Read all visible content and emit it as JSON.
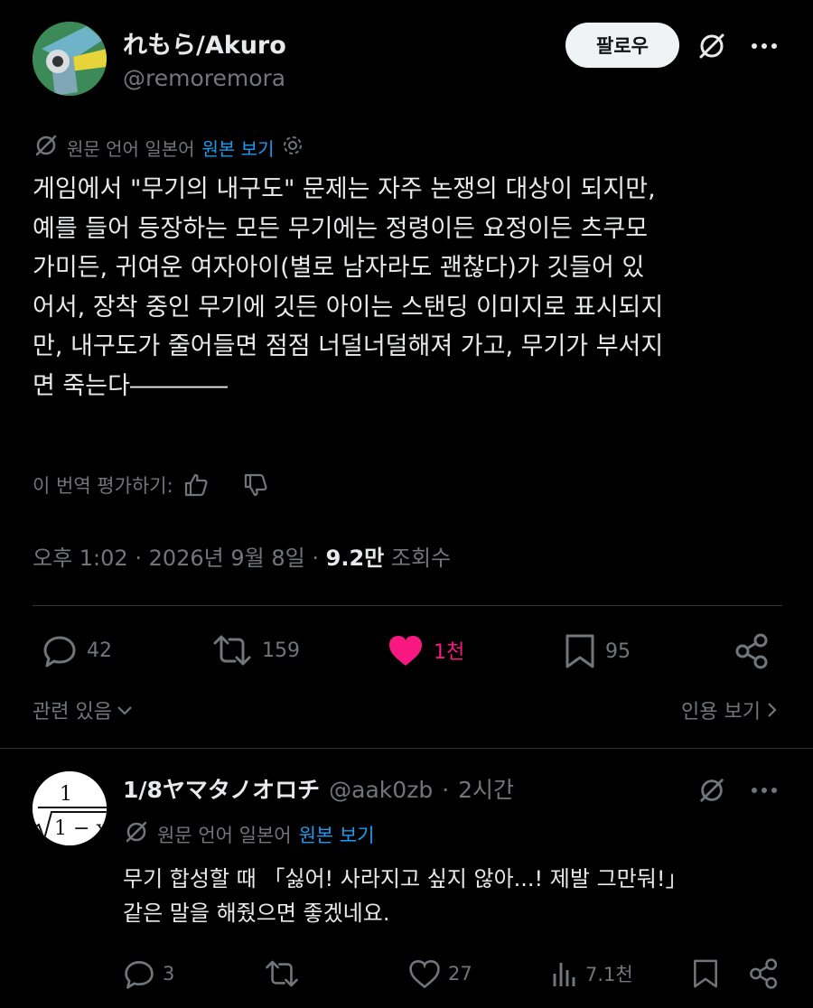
{
  "author": {
    "display_name": "れもら/Akuro",
    "handle": "@remoremora"
  },
  "header": {
    "follow_label": "팔로우"
  },
  "translation": {
    "note": "원문 언어 일본어",
    "show_original": "원본 보기"
  },
  "post": {
    "text": "게임에서 \"무기의 내구도\" 문제는 자주 논쟁의 대상이 되지만,\n예를 들어 등장하는 모든 무기에는 정령이든 요정이든 츠쿠모\n가미든, 귀여운 여자아이(별로 남자라도 괜찮다)가 깃들어 있\n어서, 장착 중인 무기에 깃든 아이는 스탠딩 이미지로 표시되지\n만, 내구도가 줄어들면 점점 너덜너덜해져 가고, 무기가 부서지\n면 죽는다――――",
    "rate_label": "이 번역 평가하기:",
    "time": "오후 1:02",
    "date": "2026년 9월 8일",
    "views_count": "9.2만",
    "views_label": "조회수"
  },
  "actions": {
    "replies": "42",
    "reposts": "159",
    "likes": "1천",
    "bookmarks": "95"
  },
  "footer": {
    "related": "관련 있음",
    "quotes": "인용 보기"
  },
  "reply": {
    "display_name": "1/8ヤマタノオロチ",
    "handle": "@aak0zb",
    "time": "2시간",
    "translation_note": "원문 언어 일본어",
    "show_original": "원본 보기",
    "text": "무기 합성할 때 「싫어! 사라지고 싶지 않아...! 제발 그만둬!」\n같은 말을 해줬으면 좋겠네요.",
    "replies": "3",
    "likes": "27",
    "views": "7.1천",
    "avatar_formula_num": "1",
    "avatar_formula_den": "1 − x"
  },
  "colors": {
    "background": "#000000",
    "text": "#e7e9ea",
    "muted": "#71767b",
    "link": "#1d9bf0",
    "like": "#f91880"
  }
}
